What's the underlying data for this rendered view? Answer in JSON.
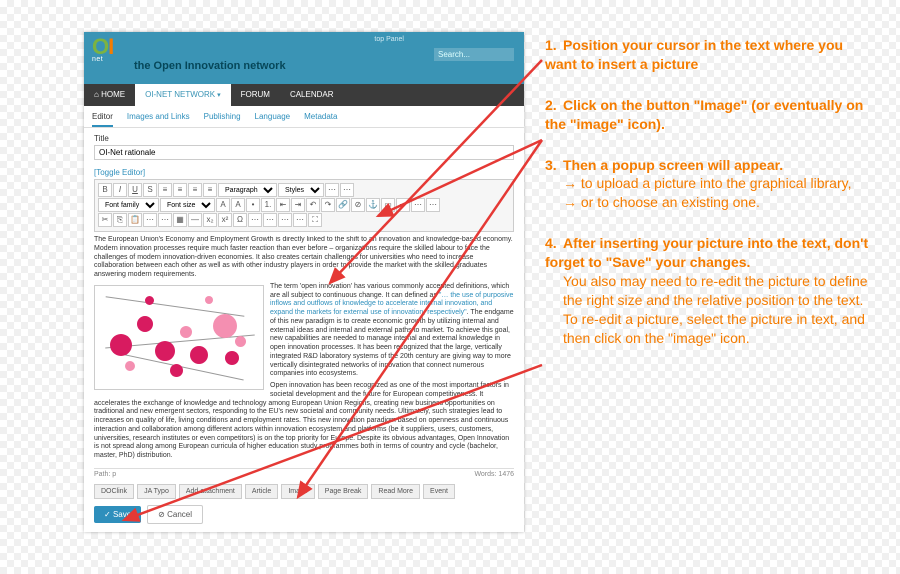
{
  "banner": {
    "logo_o": "OI",
    "logo_sub": "net",
    "tagline": "the Open Innovation network",
    "tabstrip": "top Panel",
    "search_placeholder": "Search..."
  },
  "nav": {
    "home": "HOME",
    "network": "OI-NET NETWORK",
    "forum": "FORUM",
    "calendar": "CALENDAR"
  },
  "subtabs": {
    "editor": "Editor",
    "images": "Images and Links",
    "publishing": "Publishing",
    "language": "Language",
    "metadata": "Metadata"
  },
  "form": {
    "title_label": "Title",
    "title_value": "OI-Net rationale",
    "toggle": "[Toggle Editor]"
  },
  "toolbar": {
    "font_family": "Font family",
    "font_size": "Font size",
    "paragraph": "Paragraph",
    "styles": "Styles"
  },
  "body": {
    "p1": "The European Union's Economy and Employment Growth is directly linked to the shift to an innovation and knowledge-based economy. Modern innovation processes require much faster reaction than ever before – organizations require the skilled labour to face the challenges of modern innovation-driven economies. It also creates certain challenges for universities who need to increase collaboration between each other as well as with other industry players in order to provide the market with the skilled graduates answering modern requirements.",
    "p2a": "The term 'open innovation' has various commonly accepted definitions, which are all subject to continuous change. It can defined as ",
    "p2b": "\"… the use of purposive inflows and outflows of knowledge to accelerate internal innovation, and expand the markets for external use of innovation, respectively\"",
    "p2c": ". The endgame of this new paradigm is to create economic growth by utilizing internal and external ideas and internal and external paths to market. To achieve this goal, new capabilities are needed to manage internal and external knowledge in open innovation processes. It has been recognized that the large, vertically integrated R&D laboratory systems of the 20th century are giving way to more vertically disintegrated networks of innovation that connect numerous companies into ecosystems.",
    "p3": "Open innovation has been recognized as one of the most important factors in societal development and the future for European competitiveness. It accelerates the exchange of knowledge and technology among European Union Regions, creating new business opportunities on traditional and new emergent sectors, responding to the EU's new societal and community needs. Ultimately, such strategies lead to increases on quality of life, living conditions and employment rates. This new innovation paradigm based on openness and continuous interaction and collaboration among different actors within innovation ecosystem and platforms (be it suppliers, users, customers, universities, research institutes or even competitors) is on the top priority for Europe. Despite its obvious advantages, Open Innovation is not spread along among European curricula of higher education study programmes both in terms of country and cycle (bachelor, master, PhD) distribution."
  },
  "statusbar": {
    "path": "Path: p",
    "words": "Words: 1476"
  },
  "buttons": {
    "doclink": "DOClink",
    "jatypo": "JA Typo",
    "addattach": "Add attachment",
    "article": "Article",
    "image": "Image",
    "pagebreak": "Page Break",
    "readmore": "Read More",
    "event": "Event"
  },
  "savebar": {
    "save": "Save",
    "cancel": "Cancel"
  },
  "instructions": {
    "i1": {
      "num": "1.",
      "text": "Position your cursor in the text where you want to insert a picture"
    },
    "i2": {
      "num": "2.",
      "text": "Click on the button \"Image\" (or eventually on the \"image\" icon)."
    },
    "i3": {
      "num": "3.",
      "text": "Then a popup screen will appear.",
      "a": "to upload a picture into the graphical library,",
      "b": "or to choose an existing one."
    },
    "i4": {
      "num": "4.",
      "text": "After inserting your picture into the text, don't forget to \"Save\" your changes.",
      "a": "You also may need to re-edit the picture to define the right size and the relative position to the text.",
      "b": "To re-edit a picture, select the picture in text, and then click on the \"image\" icon."
    }
  }
}
